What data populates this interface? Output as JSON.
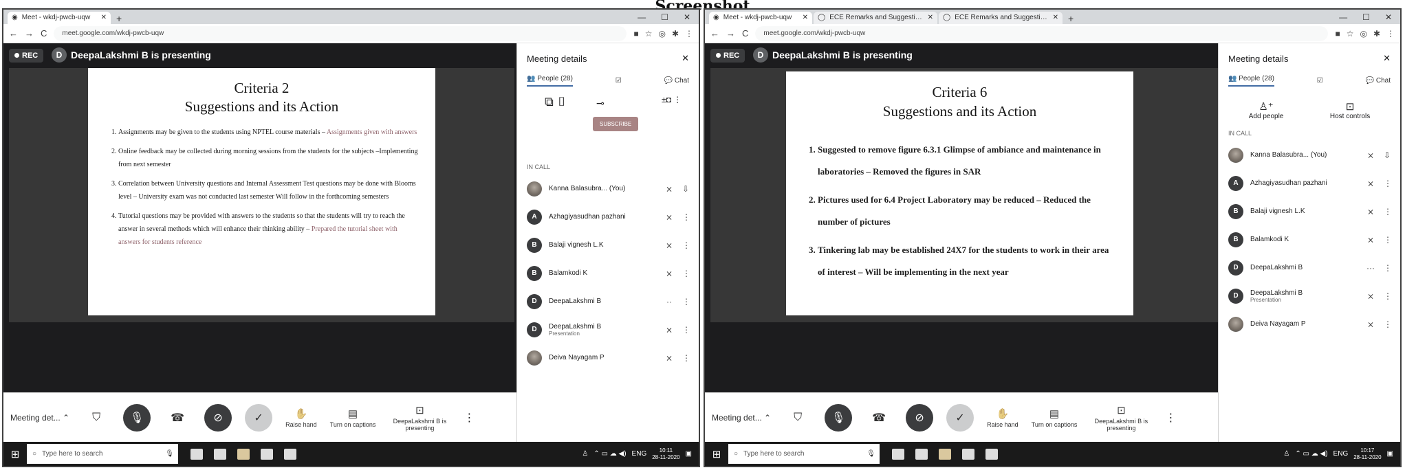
{
  "page_title": "Screenshot",
  "colors": {
    "meet_bg": "#202124",
    "slide_highlight": "#b35566",
    "taskbar": "#1f1f1f"
  },
  "left": {
    "tabs": [
      {
        "label": "Meet - wkdj-pwcb-uqw",
        "icon": "meet-icon"
      }
    ],
    "url": "meet.google.com/wkdj-pwcb-uqw",
    "rec": "REC",
    "avatar": "D",
    "presenter": "DeepaLakshmi B is presenting",
    "slide_title": "Criteria 2",
    "slide_subtitle": "Suggestions and its Action",
    "slide_items": [
      {
        "text": "Assignments may be given to the students using NPTEL course materials – ",
        "action": "Assignments given with answers"
      },
      {
        "text": "Online feedback may be collected during morning sessions from the students for the subjects –Implementing from next semester",
        "action": ""
      },
      {
        "text": "Correlation between University questions and Internal Assessment Test questions may be done with Blooms level – University exam was not conducted last semester Will follow in the forthcoming semesters",
        "action": ""
      },
      {
        "text": "Tutorial questions may be provided with answers to the students so that the students will try to reach the answer in several methods which will enhance their thinking ability – ",
        "action": "Prepared the tutorial sheet with answers for students reference"
      }
    ],
    "panel_title": "Meeting details",
    "people_tab": "People (28)",
    "chat_tab": "Chat",
    "subscribe": "SUBSCRIBE",
    "in_call": "IN CALL",
    "people": [
      {
        "name": "Kanna Balasubra...",
        "tag": "(You)",
        "initial": "",
        "sub": ""
      },
      {
        "name": "Azhagiyasudhan pazhani",
        "tag": "",
        "initial": "A",
        "sub": ""
      },
      {
        "name": "Balaji vignesh L.K",
        "tag": "",
        "initial": "B",
        "sub": ""
      },
      {
        "name": "Balamkodi K",
        "tag": "",
        "initial": "B",
        "sub": ""
      },
      {
        "name": "DeepaLakshmi B",
        "tag": "",
        "initial": "D",
        "sub": ""
      },
      {
        "name": "DeepaLakshmi B",
        "tag": "",
        "initial": "D",
        "sub": "Presentation"
      },
      {
        "name": "Deiva Nayagam P",
        "tag": "",
        "initial": "",
        "sub": ""
      }
    ],
    "meeting_details": "Meeting det...",
    "raise_hand": "Raise hand",
    "captions": "Turn on captions",
    "presenting": "DeepaLakshmi B is presenting",
    "search": "Type here to search",
    "lang": "ENG",
    "time": "10:11",
    "date": "28-11-2020"
  },
  "right": {
    "tabs": [
      {
        "label": "Meet - wkdj-pwcb-uqw",
        "icon": "meet-icon"
      },
      {
        "label": "ECE Remarks and Suggestions",
        "icon": "doc-icon"
      },
      {
        "label": "ECE Remarks and Suggestions",
        "icon": "doc-icon"
      }
    ],
    "url": "meet.google.com/wkdj-pwcb-uqw",
    "rec": "REC",
    "avatar": "D",
    "presenter": "DeepaLakshmi B is presenting",
    "slide_title": "Criteria 6",
    "slide_subtitle": "Suggestions and its Action",
    "slide_items": [
      {
        "text": "Suggested to remove figure 6.3.1 Glimpse of ambiance and maintenance in laboratories – Removed the figures in SAR"
      },
      {
        "text": "Pictures used for 6.4 Project Laboratory may be reduced – Reduced the number of pictures"
      },
      {
        "text": "Tinkering lab may be established 24X7 for the students to work in their area of interest – Will be implementing in the next year"
      }
    ],
    "panel_title": "Meeting details",
    "people_tab": "People (28)",
    "chat_tab": "Chat",
    "add_people": "Add people",
    "host_controls": "Host controls",
    "in_call": "IN CALL",
    "people": [
      {
        "name": "Kanna Balasubra...",
        "tag": "(You)",
        "initial": "",
        "sub": ""
      },
      {
        "name": "Azhagiyasudhan pazhani",
        "tag": "",
        "initial": "A",
        "sub": ""
      },
      {
        "name": "Balaji vignesh L.K",
        "tag": "",
        "initial": "B",
        "sub": ""
      },
      {
        "name": "Balamkodi K",
        "tag": "",
        "initial": "B",
        "sub": ""
      },
      {
        "name": "DeepaLakshmi B",
        "tag": "",
        "initial": "D",
        "sub": ""
      },
      {
        "name": "DeepaLakshmi B",
        "tag": "",
        "initial": "D",
        "sub": "Presentation"
      },
      {
        "name": "Deiva Nayagam P",
        "tag": "",
        "initial": "",
        "sub": ""
      }
    ],
    "meeting_details": "Meeting det...",
    "raise_hand": "Raise hand",
    "captions": "Turn on captions",
    "presenting": "DeepaLakshmi B is presenting",
    "search": "Type here to search",
    "lang": "ENG",
    "time": "10:17",
    "date": "28-11-2020"
  }
}
